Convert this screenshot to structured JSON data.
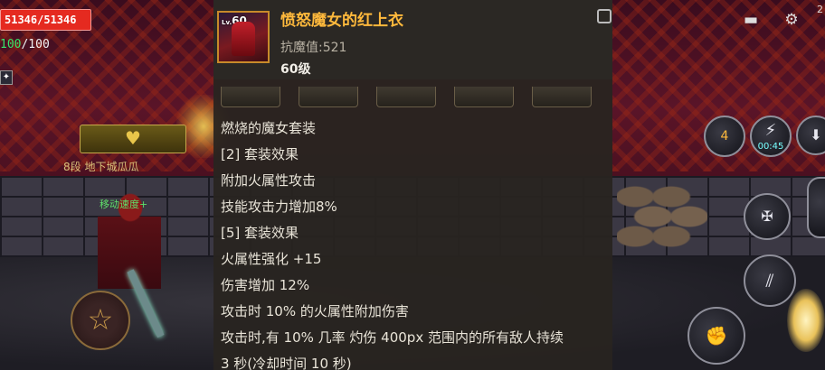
{
  "hud": {
    "hp": "51346/51346",
    "mp_current": "100",
    "mp_sep_max": "/100",
    "enemy_rank": "8段",
    "enemy_name": "地下城瓜瓜",
    "speed_buff": "移动速度+",
    "chat_icon": "chat-bubble-icon",
    "settings_icon": "gear-icon",
    "skill_cooldown_count": "4",
    "skill_timer": "00:45",
    "edge_digit": "2"
  },
  "tooltip": {
    "level_badge": "60",
    "level_badge_prefix": "Lv.",
    "item_name": "愤怒魔女的红上衣",
    "stat": "抗魔值:521",
    "level_requirement": "60级",
    "description_lines": [
      "燃烧的魔女套装",
      "[2] 套装效果",
      "附加火属性攻击",
      "技能攻击力增加8%",
      "[5] 套装效果",
      "火属性强化 +15",
      "伤害增加 12%",
      "攻击时 10% 的火属性附加伤害",
      "攻击时,有 10% 几率 灼伤 400px 范围内的所有敌人持续",
      "3 秒(冷却时间 10 秒)"
    ]
  },
  "colors": {
    "item_name": "#ffb93c",
    "hp_bar": "#e52a20",
    "mp_value": "#37e36a"
  }
}
